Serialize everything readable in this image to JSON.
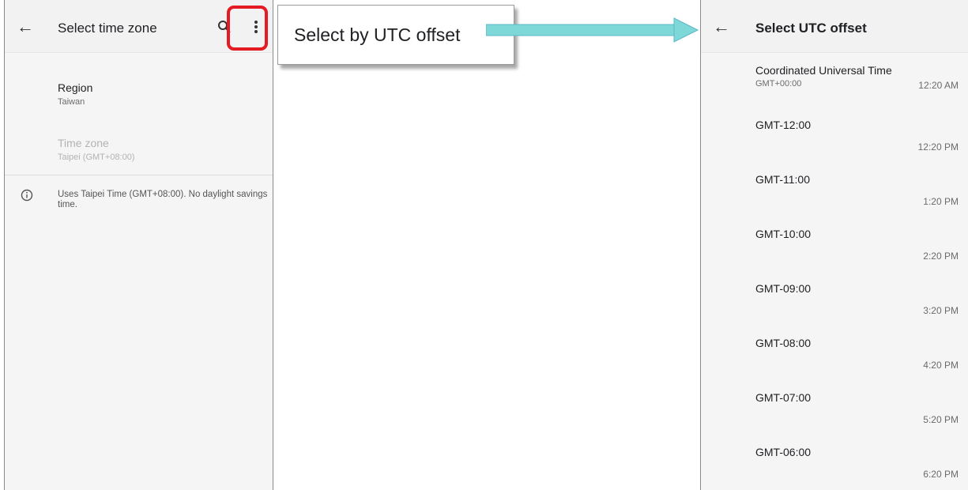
{
  "left": {
    "toolbar": {
      "title": "Select time zone"
    },
    "region": {
      "label": "Region",
      "value": "Taiwan"
    },
    "timezone": {
      "label": "Time zone",
      "value": "Taipei (GMT+08:00)"
    },
    "info": "Uses Taipei Time (GMT+08:00). No daylight savings time."
  },
  "callout": {
    "label": "Select by UTC offset"
  },
  "right": {
    "toolbar": {
      "title": "Select UTC offset"
    },
    "items": [
      {
        "name": "Coordinated Universal Time",
        "sub": "GMT+00:00",
        "time": "12:20 AM"
      },
      {
        "name": "GMT-12:00",
        "time": "12:20 PM"
      },
      {
        "name": "GMT-11:00",
        "time": "1:20 PM"
      },
      {
        "name": "GMT-10:00",
        "time": "2:20 PM"
      },
      {
        "name": "GMT-09:00",
        "time": "3:20 PM"
      },
      {
        "name": "GMT-08:00",
        "time": "4:20 PM"
      },
      {
        "name": "GMT-07:00",
        "time": "5:20 PM"
      },
      {
        "name": "GMT-06:00",
        "time": "6:20 PM"
      }
    ]
  },
  "colors": {
    "highlight": "#e51b23",
    "arrow": "#7fd8d8",
    "screen_bg": "#f5f5f5"
  }
}
